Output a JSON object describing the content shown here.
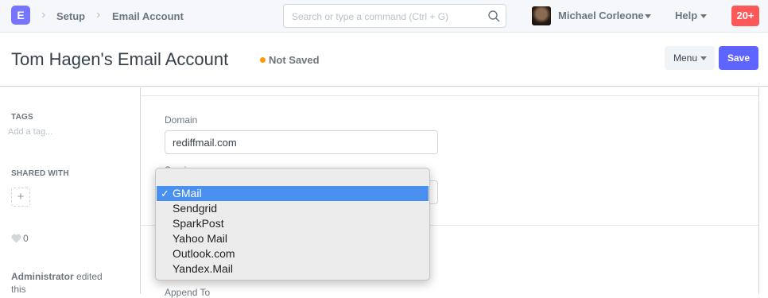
{
  "navbar": {
    "logo_letter": "E",
    "breadcrumbs": [
      "Setup",
      "Email Account"
    ],
    "search_placeholder": "Search or type a command (Ctrl + G)",
    "user_name": "Michael Corleone",
    "help_label": "Help",
    "notification_count": "20+"
  },
  "page": {
    "title": "Tom Hagen's Email Account",
    "status": "Not Saved",
    "menu_label": "Menu",
    "save_label": "Save",
    "status_color": "#ff9c00",
    "accent_color": "#5e64ff"
  },
  "sidebar": {
    "tags_label": "TAGS",
    "add_tag": "Add a tag...",
    "shared_label": "SHARED WITH",
    "likes": "0",
    "activity_user": "Administrator",
    "activity_text": "edited this"
  },
  "form": {
    "domain_label": "Domain",
    "domain_value": "rediffmail.com",
    "service_label": "Service",
    "append_label": "Append To"
  },
  "service_dropdown": {
    "selected": "GMail",
    "options": [
      "GMail",
      "Sendgrid",
      "SparkPost",
      "Yahoo Mail",
      "Outlook.com",
      "Yandex.Mail"
    ]
  }
}
